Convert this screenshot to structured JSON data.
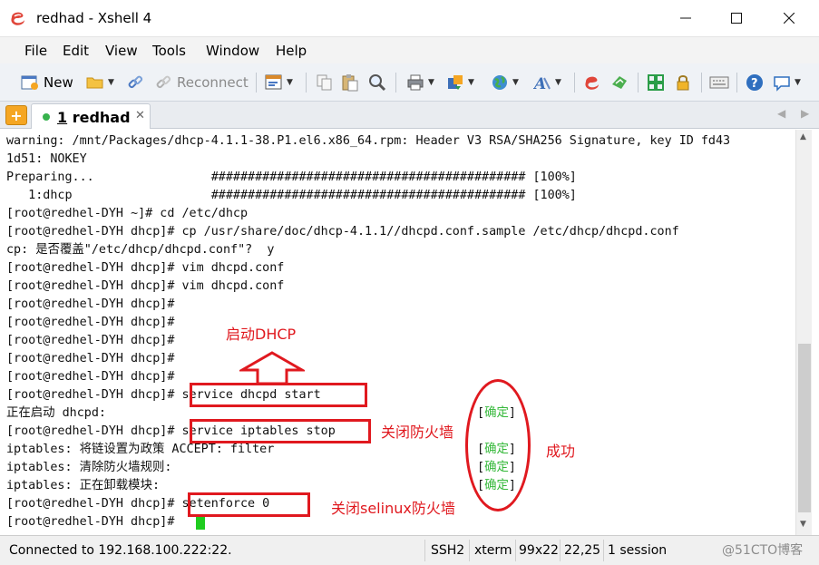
{
  "window": {
    "title": "redhad - Xshell 4"
  },
  "menu": [
    "File",
    "Edit",
    "View",
    "Tools",
    "Window",
    "Help"
  ],
  "toolbar": {
    "new_label": "New",
    "reconnect_label": "Reconnect"
  },
  "tab": {
    "number": "1",
    "name": "redhad"
  },
  "terminal": {
    "lines": [
      "warning: /mnt/Packages/dhcp-4.1.1-38.P1.el6.x86_64.rpm: Header V3 RSA/SHA256 Signature, key ID fd43",
      "1d51: NOKEY",
      "Preparing...                ########################################### [100%]",
      "   1:dhcp                   ########################################### [100%]",
      "[root@redhel-DYH ~]# cd /etc/dhcp",
      "[root@redhel-DYH dhcp]# cp /usr/share/doc/dhcp-4.1.1//dhcpd.conf.sample /etc/dhcp/dhcpd.conf",
      "cp: 是否覆盖\"/etc/dhcp/dhcpd.conf\"?  y",
      "[root@redhel-DYH dhcp]# vim dhcpd.conf",
      "[root@redhel-DYH dhcp]# vim dhcpd.conf",
      "[root@redhel-DYH dhcp]#",
      "[root@redhel-DYH dhcp]#",
      "[root@redhel-DYH dhcp]#",
      "[root@redhel-DYH dhcp]#",
      "[root@redhel-DYH dhcp]#",
      "[root@redhel-DYH dhcp]# service dhcpd start",
      "正在启动 dhcpd:",
      "[root@redhel-DYH dhcp]# service iptables stop",
      "iptables: 将链设置为政策 ACCEPT: filter",
      "iptables: 清除防火墙规则:",
      "iptables: 正在卸载模块:",
      "[root@redhel-DYH dhcp]# setenforce 0",
      "[root@redhel-DYH dhcp]# "
    ],
    "status_marks": [
      "[确定]",
      "[确定]",
      "[确定]",
      "[确定]"
    ],
    "status_word": "确定"
  },
  "annotations": {
    "start_dhcp": "启动DHCP",
    "stop_firewall": "关闭防火墙",
    "success": "成功",
    "stop_selinux": "关闭selinux防火墙"
  },
  "statusbar": {
    "connection": "Connected to 192.168.100.222:22.",
    "protocol": "SSH2",
    "terminal_type": "xterm",
    "size": "99x22",
    "cursor_pos": "22,25",
    "sessions": "1 session",
    "watermark": "@51CTO博客"
  },
  "colors": {
    "annotation": "#e0191f",
    "ok": "#35b83a",
    "cursor": "#1fcc1f"
  }
}
